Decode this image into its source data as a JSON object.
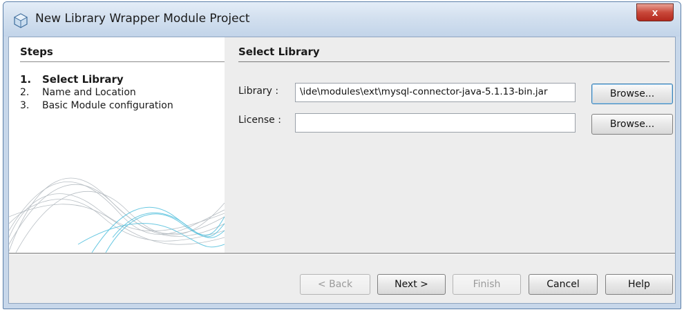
{
  "window": {
    "title": "New Library Wrapper Module Project",
    "close_glyph": "x"
  },
  "steps": {
    "heading": "Steps",
    "items": [
      {
        "num": "1.",
        "label": "Select Library"
      },
      {
        "num": "2.",
        "label": "Name and Location"
      },
      {
        "num": "3.",
        "label": "Basic Module configuration"
      }
    ]
  },
  "content": {
    "heading": "Select Library",
    "library": {
      "label": "Library :",
      "value": "\\ide\\modules\\ext\\mysql-connector-java-5.1.13-bin.jar",
      "browse_label": "Browse..."
    },
    "license": {
      "label": "License :",
      "value": "",
      "browse_label": "Browse..."
    }
  },
  "footer": {
    "back_label": "< Back",
    "next_label": "Next >",
    "finish_label": "Finish",
    "cancel_label": "Cancel",
    "help_label": "Help"
  },
  "icons": {
    "app": "netbeans-cube-icon",
    "close": "close-icon"
  },
  "colors": {
    "title_bar": "#d3e0ef",
    "close_button": "#c9483a",
    "focus_border": "#3c7fb1",
    "wave_accent": "#37b6d8"
  }
}
